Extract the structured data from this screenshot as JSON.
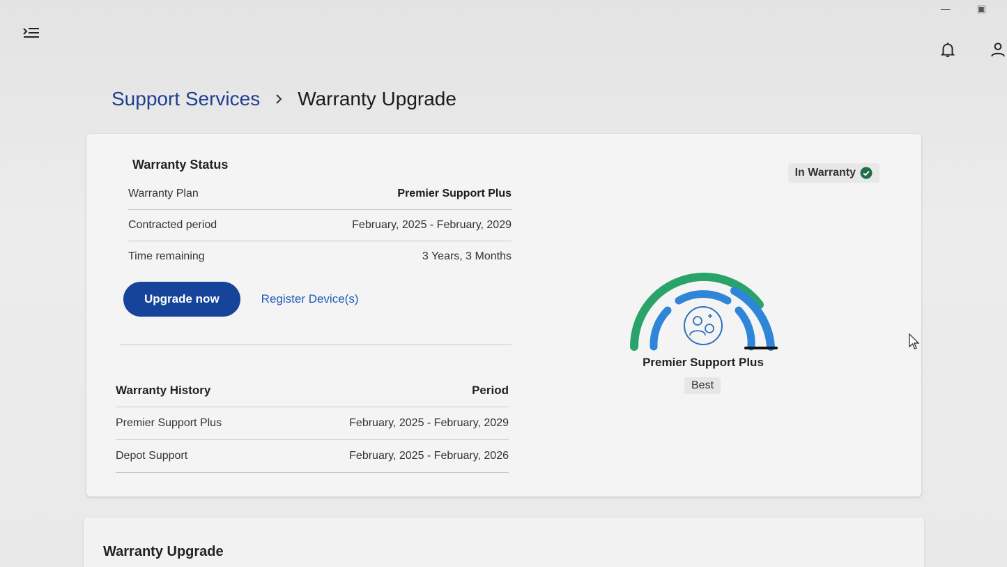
{
  "breadcrumb": {
    "parent": "Support Services",
    "current": "Warranty Upgrade"
  },
  "warranty_status": {
    "title": "Warranty Status",
    "badge": "In Warranty",
    "rows": [
      {
        "label": "Warranty Plan",
        "value": "Premier Support Plus"
      },
      {
        "label": "Contracted period",
        "value": "February, 2025 - February, 2029"
      },
      {
        "label": "Time remaining",
        "value": "3 Years, 3 Months"
      }
    ],
    "upgrade_button": "Upgrade now",
    "register_link": "Register Device(s)"
  },
  "gauge": {
    "plan_name": "Premier Support Plus",
    "tier": "Best"
  },
  "history": {
    "col_plan": "Warranty History",
    "col_period": "Period",
    "rows": [
      {
        "plan": "Premier Support Plus",
        "period": "February, 2025 - February, 2029"
      },
      {
        "plan": "Depot Support",
        "period": "February, 2025 - February, 2026"
      }
    ]
  },
  "upgrade_section": {
    "title": "Warranty Upgrade"
  },
  "colors": {
    "primary": "#15449a",
    "link": "#1f58b8",
    "gauge_green": "#2aa36b",
    "gauge_blue": "#2f86d8",
    "badge_check": "#1e6e4a"
  },
  "icons": {
    "menu": "menu-expand-icon",
    "bell": "bell-icon",
    "user": "user-icon",
    "check": "check-circle-icon",
    "support": "support-person-gear-icon"
  }
}
